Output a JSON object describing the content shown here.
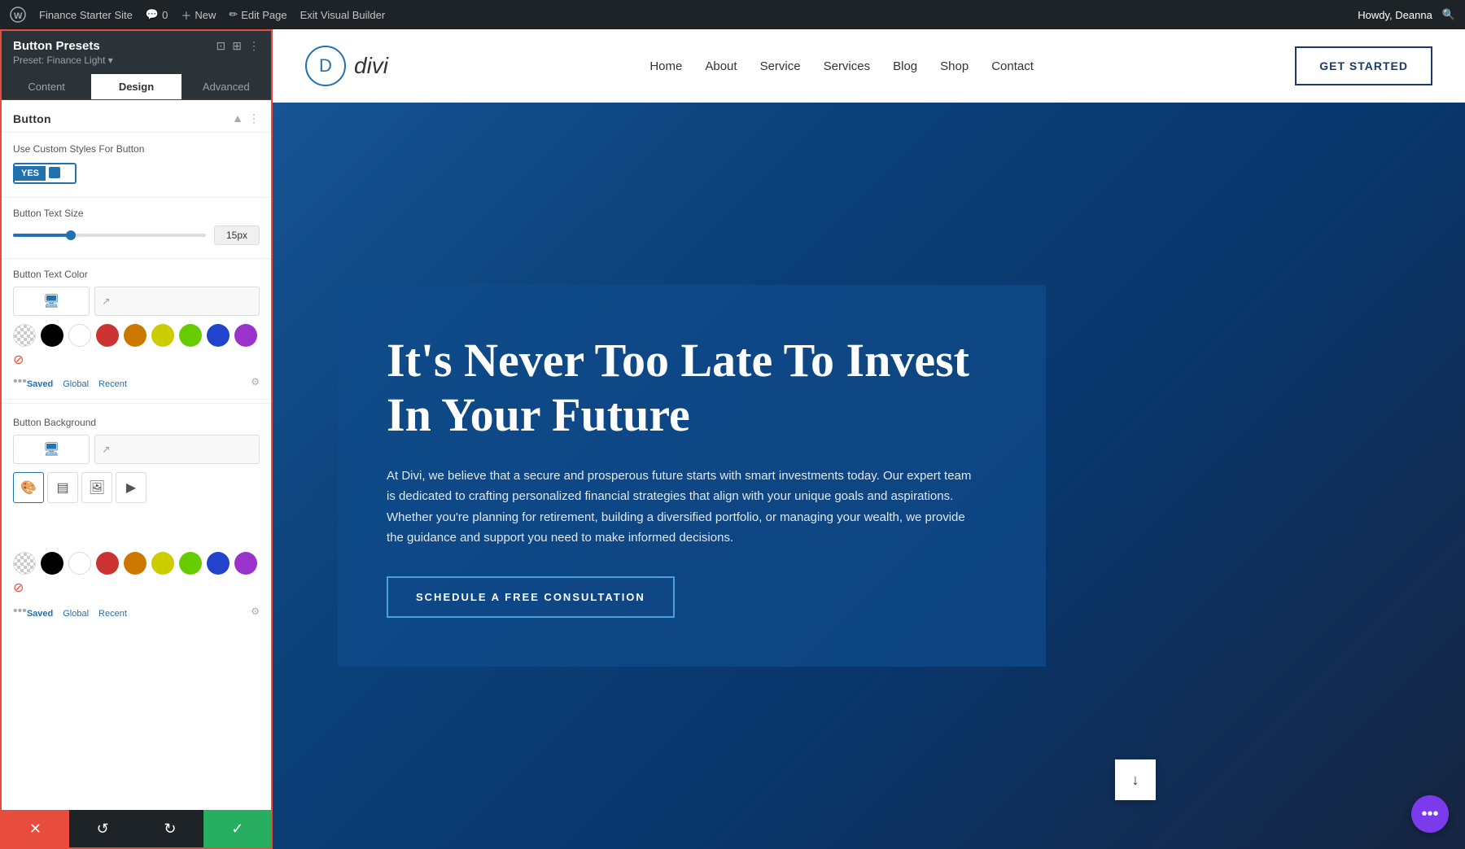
{
  "adminBar": {
    "wpLogo": "W",
    "siteName": "Finance Starter Site",
    "commentCount": "0",
    "newLabel": "New",
    "editPageLabel": "Edit Page",
    "exitBuilderLabel": "Exit Visual Builder",
    "userGreeting": "Howdy, Deanna"
  },
  "leftPanel": {
    "title": "Button Presets",
    "preset": "Preset: Finance Light ▾",
    "tabs": [
      "Content",
      "Design",
      "Advanced"
    ],
    "activeTab": "Design",
    "section": {
      "title": "Button",
      "toggleLabel": "Use Custom Styles For Button",
      "toggleYes": "YES",
      "textSizeLabel": "Button Text Size",
      "textSizeValue": "15px",
      "textColorLabel": "Button Text Color",
      "backgroundLabel": "Button Background",
      "colorTabs": [
        "Saved",
        "Global",
        "Recent"
      ],
      "swatchColors": [
        "#000000",
        "#ffffff",
        "#cc3333",
        "#cc7700",
        "#cccc00",
        "#66cc00",
        "#2244cc",
        "#9933cc"
      ],
      "bgTypes": [
        "color",
        "gradient",
        "image",
        "video"
      ]
    },
    "bottomActions": {
      "cancel": "✕",
      "undo": "↺",
      "redo": "↻",
      "save": "✓"
    }
  },
  "siteNav": {
    "logoLetter": "D",
    "logoText": "divi",
    "menuItems": [
      "Home",
      "About",
      "Service",
      "Services",
      "Blog",
      "Shop",
      "Contact"
    ],
    "ctaLabel": "GET STARTED"
  },
  "hero": {
    "title": "It's Never Too Late To Invest In Your Future",
    "description": "At Divi, we believe that a secure and prosperous future starts with smart investments today. Our expert team is dedicated to crafting personalized financial strategies that align with your unique goals and aspirations. Whether you're planning for retirement, building a diversified portfolio, or managing your wealth, we provide the guidance and support you need to make informed decisions.",
    "ctaLabel": "SCHEDULE A FREE CONSULTATION",
    "downArrow": "↓",
    "fab": "•••"
  }
}
